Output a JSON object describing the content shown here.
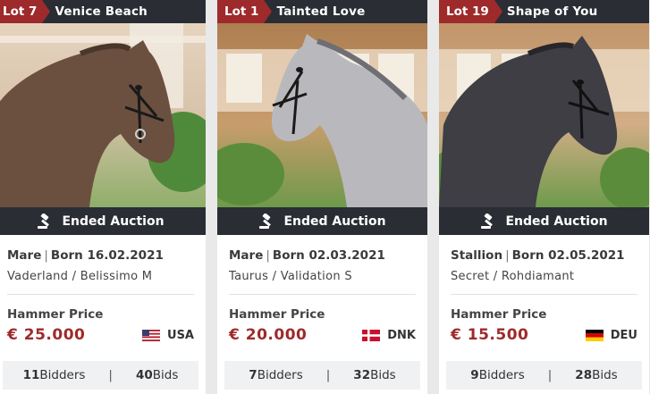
{
  "cards": [
    {
      "lot": "Lot 7",
      "name": "Venice Beach",
      "status": "Ended Auction",
      "sex": "Mare",
      "born": "Born 16.02.2021",
      "pedigree": "Vaderland / Belissimo M",
      "hammer_label": "Hammer Price",
      "price": "€ 25.000",
      "country": "USA",
      "flag_icon": "usa-flag-icon",
      "bidders": "11",
      "bidders_label": "Bidders",
      "bids": "40",
      "bids_label": "Bids",
      "horse_color": "#6b5040"
    },
    {
      "lot": "Lot 1",
      "name": "Tainted Love",
      "status": "Ended Auction",
      "sex": "Mare",
      "born": "Born 02.03.2021",
      "pedigree": "Taurus / Validation S",
      "hammer_label": "Hammer Price",
      "price": "€ 20.000",
      "country": "DNK",
      "flag_icon": "denmark-flag-icon",
      "bidders": "7",
      "bidders_label": "Bidders",
      "bids": "32",
      "bids_label": "Bids",
      "horse_color": "#b9b9bd"
    },
    {
      "lot": "Lot 19",
      "name": "Shape of You",
      "status": "Ended Auction",
      "sex": "Stallion",
      "born": "Born 02.05.2021",
      "pedigree": "Secret / Rohdiamant",
      "hammer_label": "Hammer Price",
      "price": "€ 15.500",
      "country": "DEU",
      "flag_icon": "germany-flag-icon",
      "bidders": "9",
      "bidders_label": "Bidders",
      "bids": "28",
      "bids_label": "Bids",
      "horse_color": "#3e3e44"
    }
  ],
  "colors": {
    "accent": "#9e2a2b",
    "bar": "#2a2d34",
    "stats_bg": "#f0f1f3"
  }
}
